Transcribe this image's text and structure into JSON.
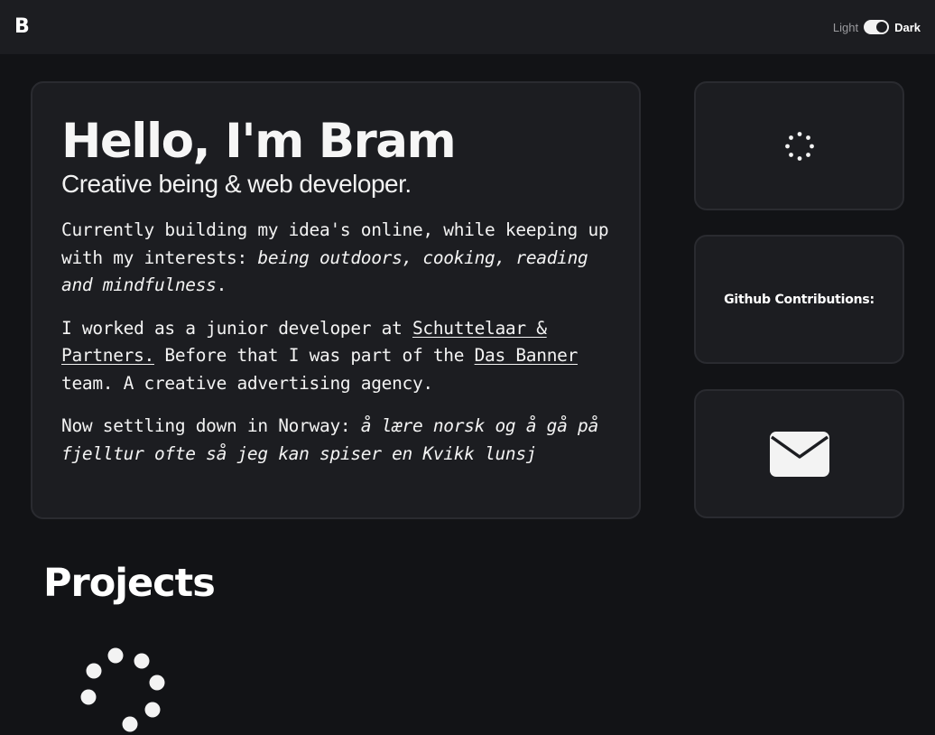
{
  "header": {
    "logo": "B",
    "theme_light": "Light",
    "theme_dark": "Dark",
    "theme_state": "dark"
  },
  "intro": {
    "title": "Hello, I'm Bram",
    "subtitle": "Creative being & web developer.",
    "p1_text": "Currently building my idea's online, while keeping up with my interests: ",
    "p1_em": "being outdoors, cooking, reading and mindfulness",
    "p1_end": ".",
    "p2_text1": "I worked as a junior developer at ",
    "p2_link1": "Schuttelaar & Partners.",
    "p2_text2": " Before that I was part of the ",
    "p2_link2": "Das Banner",
    "p2_text3": " team. A creative advertising agency.",
    "p3_text": "Now settling down in Norway: ",
    "p3_em": "å lære norsk og å gå på fjelltur ofte så jeg kan spiser en Kvikk lunsj"
  },
  "side": {
    "github_label": "Github Contributions:"
  },
  "icons": {
    "top_card": "loading-spinner-icon",
    "bottom_card": "mail-icon",
    "projects": "loading-spinner-icon"
  },
  "projects": {
    "heading": "Projects"
  },
  "colors": {
    "background": "#121316",
    "card": "#1c1d21",
    "card_border": "#2a2b30",
    "text": "#f3f3f3"
  }
}
